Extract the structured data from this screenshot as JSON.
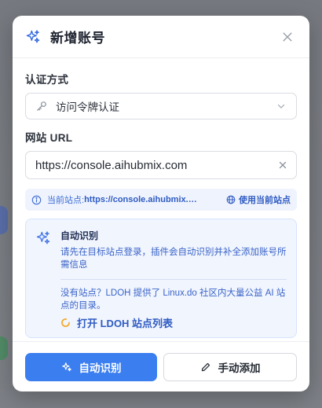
{
  "dialog": {
    "title": "新增账号",
    "close_icon": "close-icon",
    "header_icon": "sparkles-icon"
  },
  "auth": {
    "label": "认证方式",
    "selected": "访问令牌认证",
    "icon": "key-icon"
  },
  "url": {
    "label": "网站 URL",
    "value": "https://console.aihubmix.com"
  },
  "current_site": {
    "label": "当前站点: ",
    "url": "https://console.aihubmix.com",
    "use_label": "使用当前站点"
  },
  "auto_detect": {
    "title": "自动识别",
    "description": "请先在目标站点登录，插件会自动识别并补全添加账号所需信息",
    "note": "没有站点？LDOH 提供了 Linux.do 社区内大量公益 AI 站点的目录。",
    "open_link": "打开 LDOH 站点列表"
  },
  "footer": {
    "auto_button": "自动识别",
    "manual_button": "手动添加"
  },
  "colors": {
    "accent": "#3b7ef0",
    "info_text": "#3a64c8",
    "spinner": "#f5a623"
  }
}
